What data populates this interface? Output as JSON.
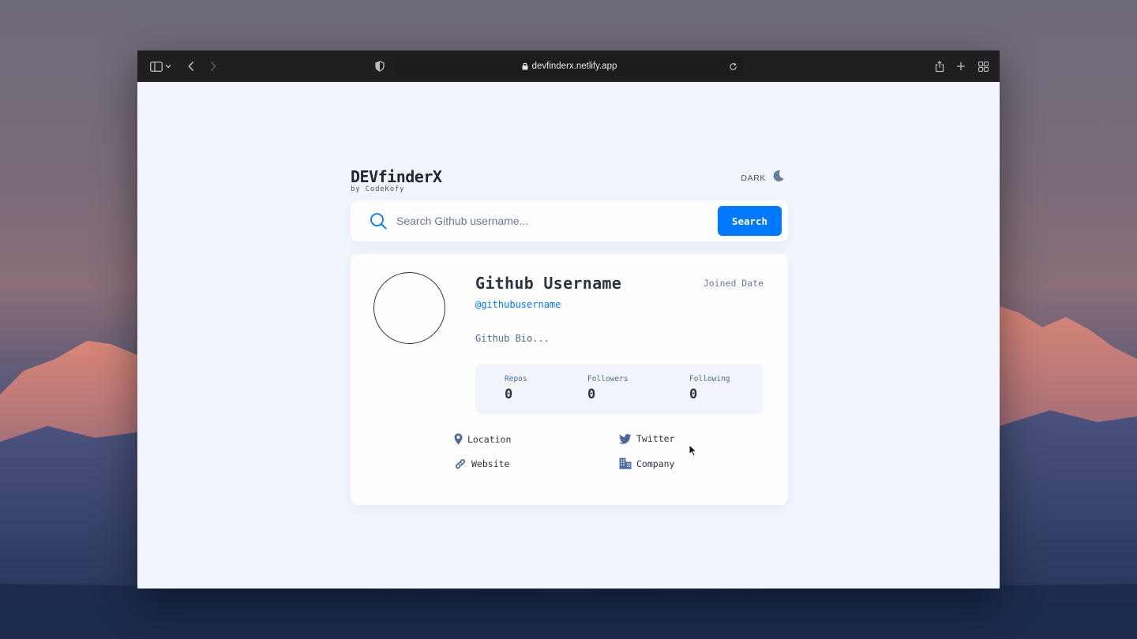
{
  "browser": {
    "url": "devfinderx.netlify.app"
  },
  "app": {
    "brand_title": "DEVfinderX",
    "brand_subtitle": "by CodeKofy",
    "theme_label": "DARK",
    "search": {
      "placeholder": "Search Github username...",
      "value": "",
      "button_label": "Search"
    },
    "profile": {
      "name": "Github Username",
      "handle": "@githubusername",
      "joined": "Joined Date",
      "bio": "Github Bio...",
      "stats": [
        {
          "label": "Repos",
          "value": "0"
        },
        {
          "label": "Followers",
          "value": "0"
        },
        {
          "label": "Following",
          "value": "0"
        }
      ],
      "links": {
        "location": "Location",
        "twitter": "Twitter",
        "website": "Website",
        "company": "Company"
      }
    }
  },
  "colors": {
    "accent": "#0079ff",
    "text_dark": "#2b3442",
    "text_muted": "#4b6a9b",
    "page_bg": "#f2f6fc",
    "card_bg": "#fefefe"
  },
  "icons": {
    "toolbar": [
      "sidebar-icon",
      "chevron-down-icon",
      "back-icon",
      "forward-icon",
      "shield-icon",
      "lock-icon",
      "reload-icon",
      "share-icon",
      "plus-icon",
      "tab-grid-icon"
    ],
    "app": [
      "moon-icon",
      "search-icon",
      "location-pin-icon",
      "twitter-icon",
      "link-icon",
      "building-icon"
    ]
  }
}
